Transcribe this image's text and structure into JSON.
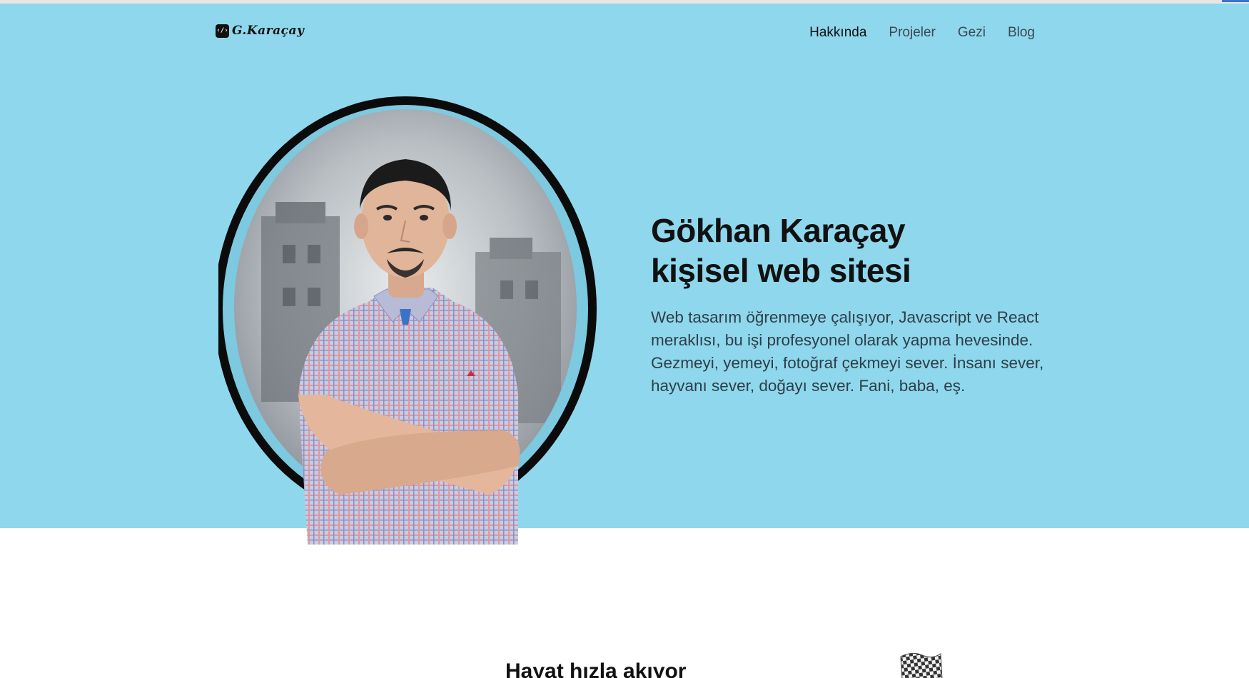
{
  "header": {
    "logo_text": "G.Karaçay",
    "logo_icon": "code-brackets-icon",
    "nav": [
      {
        "label": "Hakkında",
        "active": true
      },
      {
        "label": "Projeler",
        "active": false
      },
      {
        "label": "Gezi",
        "active": false
      },
      {
        "label": "Blog",
        "active": false
      }
    ]
  },
  "hero": {
    "title_line1": "Gökhan Karaçay",
    "title_line2": "kişisel web sitesi",
    "description": "Web tasarım öğrenmeye çalışıyor, Javascript ve React meraklısı, bu işi profesyonel olarak yapma hevesinde. Gezmeyi, yemeyi, fotoğraf çekmeyi sever. İnsanı sever, hayvanı sever, doğayı sever. Fani, baba, eş."
  },
  "section": {
    "title": "Hayat hızla akıyor",
    "icon": "checkered-flag-icon"
  },
  "colors": {
    "hero_background": "#8fd7ec",
    "text_dark": "#111111",
    "text_muted": "#2d3e49"
  }
}
